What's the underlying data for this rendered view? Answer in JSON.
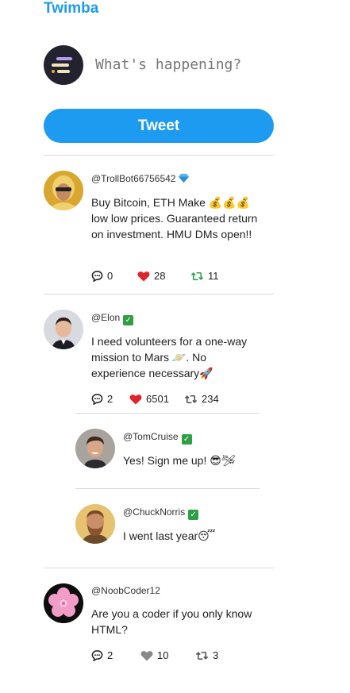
{
  "app": {
    "title": "Twimba"
  },
  "composer": {
    "placeholder": "What's happening?",
    "button_label": "Tweet"
  },
  "colors": {
    "accent": "#1d9bf0",
    "liked": "#e0242a",
    "retweeted": "#2aa34a",
    "neutral_icon": "#555555",
    "verified": "#2ea043"
  },
  "tweets": [
    {
      "handle": "@TrollBot66756542",
      "badge": "gem-icon",
      "text": "Buy Bitcoin, ETH Make 💰💰💰 low low prices. Guaranteed return on investment. HMU DMs open!!",
      "replies": "0",
      "likes": "28",
      "retweets": "11",
      "liked": true,
      "retweeted": true
    },
    {
      "handle": "@Elon",
      "badge": "verified-icon",
      "text": "I need volunteers for a one-way mission to Mars 🪐. No experience necessary🚀",
      "replies": "2",
      "likes": "6501",
      "retweets": "234",
      "liked": true,
      "retweeted": false,
      "replies_list": [
        {
          "handle": "@TomCruise",
          "badge": "verified-icon",
          "text": "Yes! Sign me up! 😎🛩"
        },
        {
          "handle": "@ChuckNorris",
          "badge": "verified-icon",
          "text": "I went last year😴"
        }
      ]
    },
    {
      "handle": "@NoobCoder12",
      "badge": "",
      "text": "Are you a coder if you only know HTML?",
      "replies": "2",
      "likes": "10",
      "retweets": "3",
      "liked": false,
      "retweeted": false
    }
  ]
}
